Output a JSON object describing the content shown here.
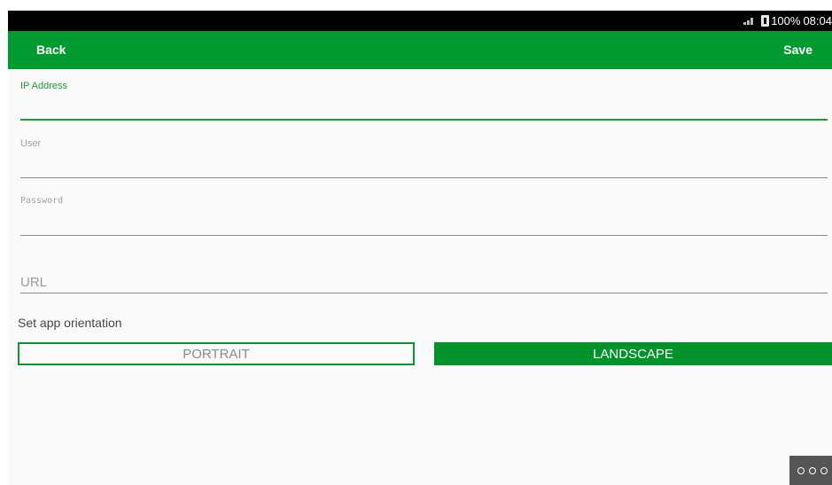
{
  "status_bar": {
    "battery": "100%",
    "time": "08:04",
    "icons": [
      "wifi-icon",
      "battery-charging-icon"
    ]
  },
  "app_bar": {
    "back_label": "Back",
    "save_label": "Save"
  },
  "form": {
    "ip_address": {
      "label": "IP Address",
      "value": ""
    },
    "user": {
      "label": "User",
      "value": ""
    },
    "password": {
      "label": "Password",
      "value": ""
    },
    "url": {
      "placeholder": "URL",
      "value": ""
    }
  },
  "orientation": {
    "label": "Set app orientation",
    "options": [
      "PORTRAIT",
      "LANDSCAPE"
    ],
    "selected": "LANDSCAPE"
  },
  "nav": {
    "icon": "more-dots-icon"
  },
  "colors": {
    "accent": "#009a31",
    "status_bar": "#000000",
    "background": "#fafafa"
  }
}
